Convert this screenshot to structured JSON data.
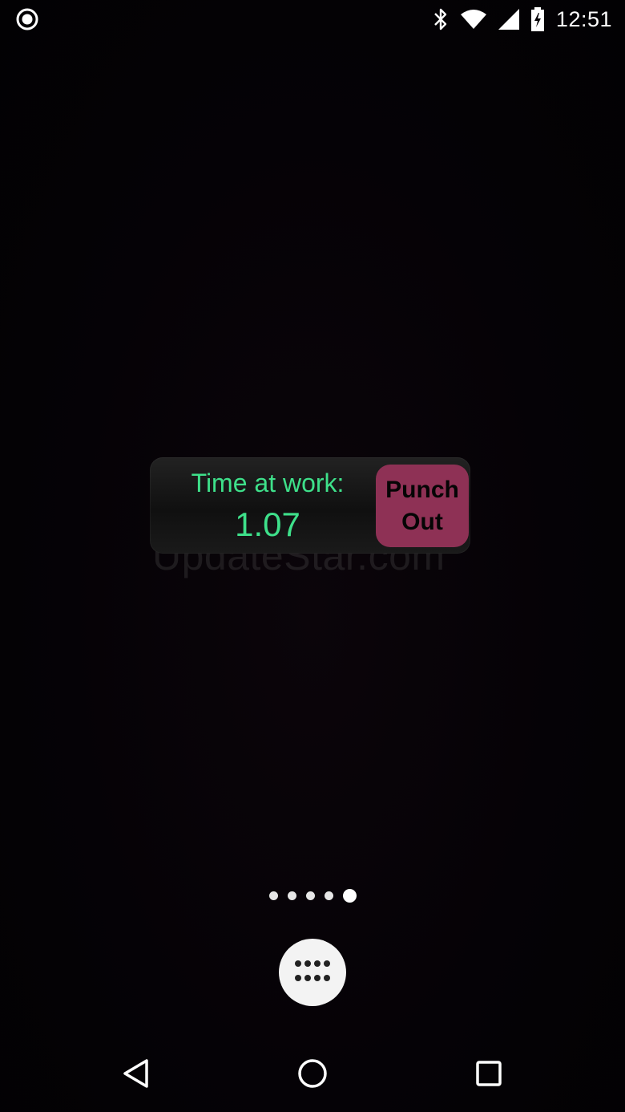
{
  "status_bar": {
    "left_icon": "circle-record-icon",
    "icons": [
      "bluetooth-icon",
      "wifi-icon",
      "cell-signal-icon",
      "battery-icon"
    ],
    "time": "12:51"
  },
  "widget": {
    "label": "Time at work:",
    "value": "1.07",
    "button_line1": "Punch",
    "button_line2": "Out",
    "label_color": "#3ee08a",
    "button_color": "#8e3155"
  },
  "watermark": "UpdateStar.com",
  "page_indicator": {
    "count": 5,
    "active_index": 4
  },
  "dock": {
    "app_drawer_icon": "grid-dots-icon"
  },
  "nav_bar": {
    "back_icon": "back-triangle-icon",
    "home_icon": "home-circle-icon",
    "recents_icon": "recents-square-icon"
  }
}
